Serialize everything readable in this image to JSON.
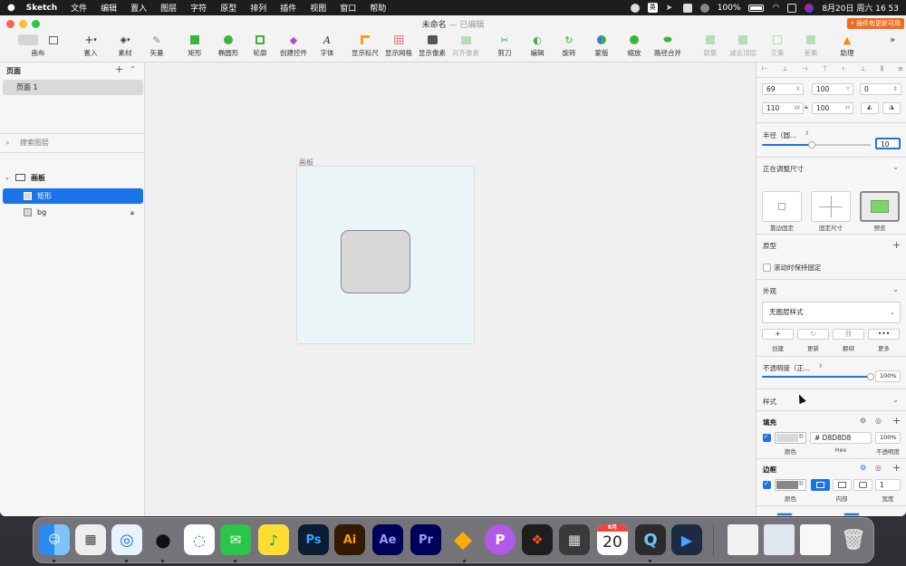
{
  "menubar": {
    "items": [
      "Sketch",
      "文件",
      "编辑",
      "置入",
      "图层",
      "字符",
      "原型",
      "排列",
      "插件",
      "视图",
      "窗口",
      "帮助"
    ],
    "input_method": "英",
    "battery": "100%",
    "datetime": "8月20日 周六 16 53"
  },
  "window": {
    "title": "未命名",
    "title_sep": " — ",
    "subtitle": "已编辑",
    "update_badge": "• 插件有更新可用"
  },
  "toolbar": {
    "canvas": "画布",
    "insert": "置入",
    "assets": "素材",
    "vector": "矢量",
    "rectangle": "矩形",
    "oval": "椭圆形",
    "outline": "轮廓",
    "create_component": "创建控件",
    "text": "字体",
    "show_rulers": "显示标尺",
    "show_grid": "显示网格",
    "show_pixels": "显示像素",
    "align_pixels": "对齐像素",
    "scissors": "剪刀",
    "edit": "编辑",
    "rotate": "旋转",
    "mask": "蒙版",
    "scale": "缩放",
    "path_combine": "路径合并",
    "union": "联集",
    "subtract": "减去顶层",
    "intersect": "交集",
    "difference": "差集",
    "assistant": "助理"
  },
  "left_panel": {
    "pages_title": "页面",
    "pages": [
      "页面 1"
    ],
    "search_placeholder": "搜索图层",
    "artboard_name": "画板",
    "layers": [
      "矩形",
      "bg"
    ]
  },
  "canvas": {
    "artboard_label": "画板",
    "artboard_color": "#E9F5F6",
    "rect_color": "#D8D8D8"
  },
  "inspector": {
    "x": "69",
    "x_unit": "X",
    "y": "100",
    "y_unit": "Y",
    "rotation": "0",
    "width": "110",
    "w_unit": "W",
    "height": "100",
    "h_unit": "H",
    "radius_label": "半径（圆...",
    "radius_value": "10",
    "resizing_title": "正在调整尺寸",
    "resizing_options": [
      "靠边固定",
      "固定尺寸",
      "预览"
    ],
    "prototype_title": "原型",
    "fix_on_scroll": "滚动时保持固定",
    "appearance_title": "外观",
    "layer_style": "无图层样式",
    "style_actions": [
      "创建",
      "更新",
      "解绑",
      "更多"
    ],
    "opacity_label": "不透明度（正...",
    "opacity_value": "100%",
    "opacity_fraction": 1.0,
    "style_title": "样式",
    "fill_title": "填充",
    "fill_hex": "# D8D8D8",
    "fill_opacity": "100%",
    "fill_color_label": "颜色",
    "fill_hex_label": "Hex",
    "fill_opacity_label": "不透明度",
    "border_title": "边框",
    "border_color_label": "颜色",
    "border_position_label": "内部",
    "border_width": "1",
    "border_width_label": "宽度"
  },
  "dock": {
    "calendar_month": "8月",
    "calendar_day": "20"
  }
}
